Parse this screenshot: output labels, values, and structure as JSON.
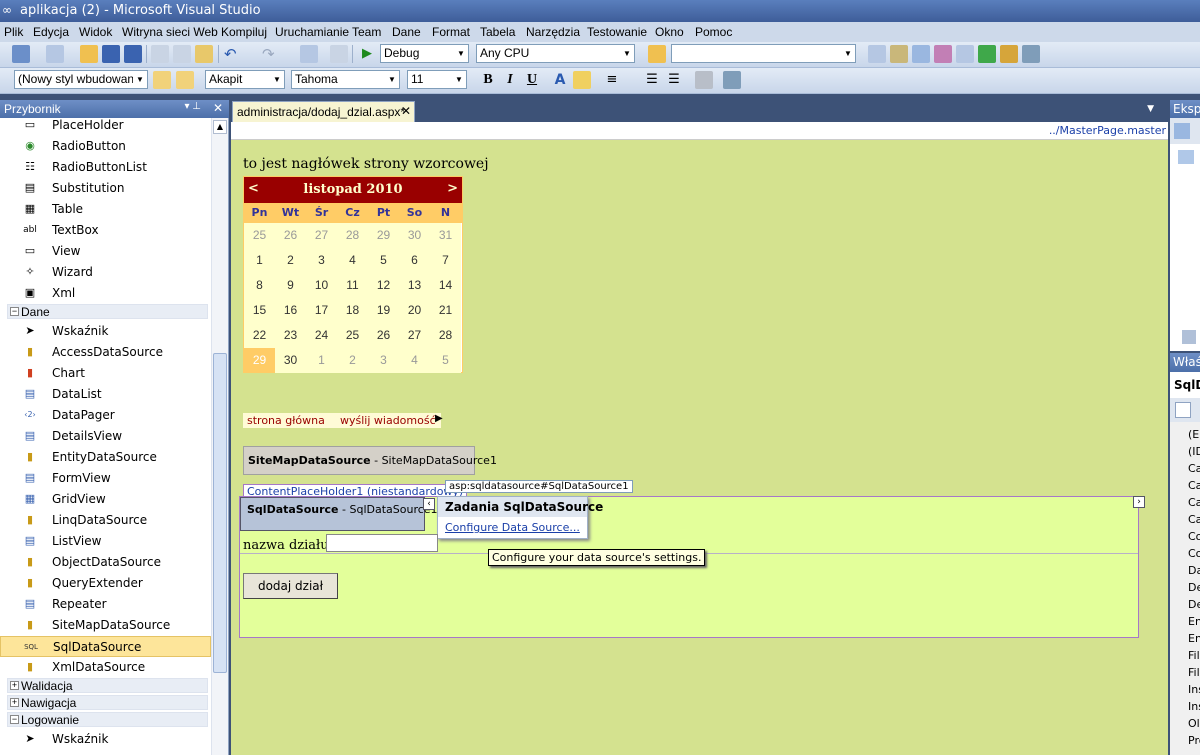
{
  "window": {
    "title": "aplikacja (2) - Microsoft Visual Studio"
  },
  "menu": [
    "Plik",
    "Edycja",
    "Widok",
    "Witryna sieci Web",
    "Kompiluj",
    "Uruchamianie",
    "Team",
    "Dane",
    "Format",
    "Tabela",
    "Narzędzia",
    "Testowanie",
    "Okno",
    "Pomoc"
  ],
  "toolbar1": {
    "config": "Debug",
    "platform": "Any CPU",
    "search": ""
  },
  "toolbar2": {
    "style": "(Nowy styl wbudowany)",
    "block": "Akapit",
    "font": "Tahoma",
    "size": "11",
    "bold": "B",
    "italic": "I",
    "underline": "U"
  },
  "toolbox": {
    "title": "Przybornik",
    "items_top": [
      "PlaceHolder",
      "RadioButton",
      "RadioButtonList",
      "Substitution",
      "Table",
      "TextBox",
      "View",
      "Wizard",
      "Xml"
    ],
    "cat_dane": "Dane",
    "items_dane": [
      "Wskaźnik",
      "AccessDataSource",
      "Chart",
      "DataList",
      "DataPager",
      "DetailsView",
      "EntityDataSource",
      "FormView",
      "GridView",
      "LinqDataSource",
      "ListView",
      "ObjectDataSource",
      "QueryExtender",
      "Repeater",
      "SiteMapDataSource",
      "SqlDataSource",
      "XmlDataSource"
    ],
    "cat_walidacja": "Walidacja",
    "cat_nawigacja": "Nawigacja",
    "cat_logowanie": "Logowanie",
    "item_logowanie": "Wskaźnik"
  },
  "editor": {
    "tab": "administracja/dodaj_dzial.aspx*",
    "master": "../MasterPage.master",
    "heading": "to jest nagłówek strony wzorcowej",
    "calendar": {
      "month": "listopad 2010",
      "prev": "<",
      "next": ">",
      "dow": [
        "Pn",
        "Wt",
        "Śr",
        "Cz",
        "Pt",
        "So",
        "N"
      ],
      "weeks": [
        [
          "25",
          "26",
          "27",
          "28",
          "29",
          "30",
          "31"
        ],
        [
          "1",
          "2",
          "3",
          "4",
          "5",
          "6",
          "7"
        ],
        [
          "8",
          "9",
          "10",
          "11",
          "12",
          "13",
          "14"
        ],
        [
          "15",
          "16",
          "17",
          "18",
          "19",
          "20",
          "21"
        ],
        [
          "22",
          "23",
          "24",
          "25",
          "26",
          "27",
          "28"
        ],
        [
          "29",
          "30",
          "1",
          "2",
          "3",
          "4",
          "5"
        ]
      ]
    },
    "menu_links": [
      "strona główna",
      "wyślij wiadomość"
    ],
    "sitemap_ds": {
      "bold": "SiteMapDataSource",
      "rest": " - SiteMapDataSource1"
    },
    "cph_label": "ContentPlaceHolder1 (niestandardowy)",
    "sql_tag": "asp:sqldatasource#SqlDataSource1",
    "sql_ds": {
      "bold": "SqlDataSource",
      "rest": " - SqlDataSource1"
    },
    "tasks": {
      "title": "Zadania SqlDataSource",
      "link": "Configure Data Source...",
      "tooltip": "Configure your data source's settings."
    },
    "field_label": "nazwa działu:",
    "button": "dodaj dział"
  },
  "right": {
    "solexp_title": "Eksplo",
    "props_title": "Właśc",
    "props_object": "SqlD",
    "props_rows": [
      "(E",
      "(ID",
      "Ca",
      "Ca",
      "Ca",
      "Ca",
      "Co",
      "Co",
      "Da",
      "De",
      "De",
      "En",
      "En",
      "Fil",
      "Fil",
      "Ins",
      "Ins",
      "Ole",
      "Pro"
    ]
  }
}
